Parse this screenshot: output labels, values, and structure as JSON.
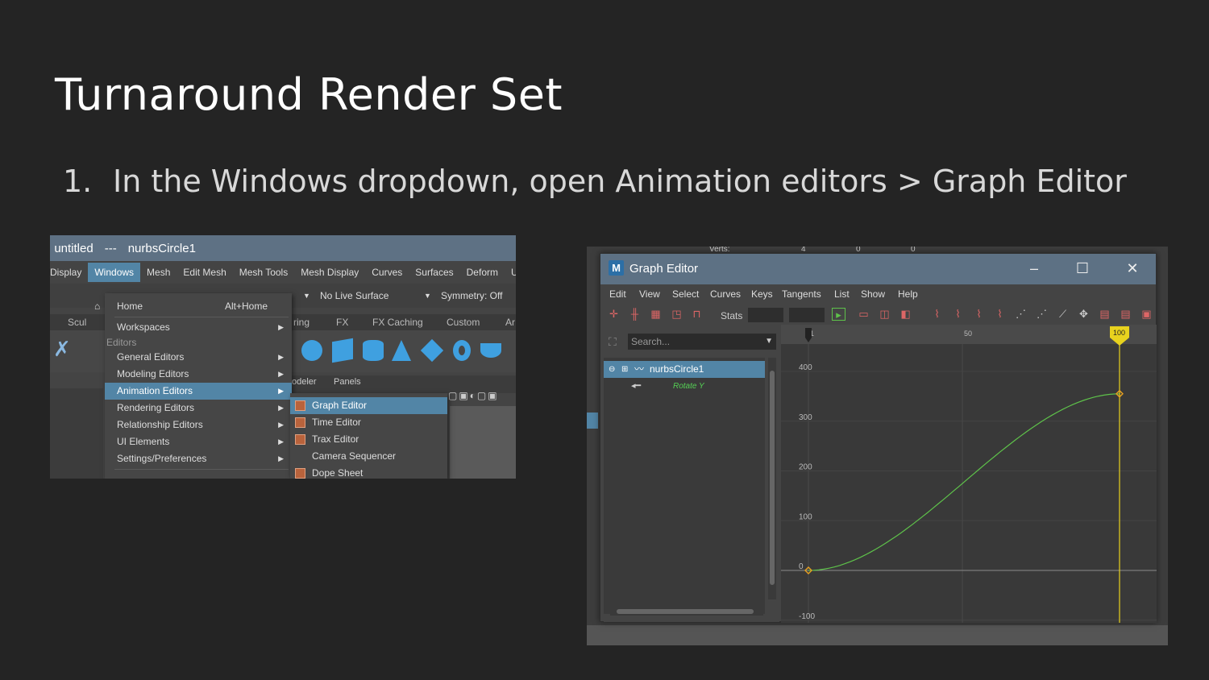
{
  "slide": {
    "title": "Turnaround Render Set",
    "step_number": "1.",
    "step_text": "In the Windows dropdown, open Animation editors > Graph Editor"
  },
  "maya_menu": {
    "title_prefix": ": untitled",
    "title_sep": "---",
    "title_object": "nurbsCircle1",
    "menubar": [
      "Display",
      "Windows",
      "Mesh",
      "Edit Mesh",
      "Mesh Tools",
      "Mesh Display",
      "Curves",
      "Surfaces",
      "Deform",
      "UV"
    ],
    "active_menu": "Windows",
    "live_surface": "No Live Surface",
    "symmetry": "Symmetry: Off",
    "shelf_tabs": [
      "Scul",
      "ring",
      "FX",
      "FX Caching",
      "Custom",
      "Ar"
    ],
    "panel_tabs": [
      "odeler",
      "Panels"
    ],
    "windows_menu": {
      "home": "Home",
      "home_shortcut": "Alt+Home",
      "workspaces": "Workspaces",
      "editors_section": "Editors",
      "items": [
        "General Editors",
        "Modeling Editors",
        "Animation Editors",
        "Rendering Editors",
        "Relationship Editors",
        "UI Elements",
        "Settings/Preferences"
      ],
      "highlighted": "Animation Editors"
    },
    "animation_submenu": [
      "Graph Editor",
      "Time Editor",
      "Trax Editor",
      "Camera Sequencer",
      "Dope Sheet"
    ],
    "animation_submenu_highlighted": "Graph Editor"
  },
  "graph_editor": {
    "title": "Graph Editor",
    "background_text": "Verts:",
    "background_values": [
      "4",
      "0",
      "0"
    ],
    "menus": [
      "Edit",
      "View",
      "Select",
      "Curves",
      "Keys",
      "Tangents",
      "List",
      "Show",
      "Help"
    ],
    "stats_label": "Stats",
    "search_placeholder": "Search...",
    "node": "nurbsCircle1",
    "attribute": "Rotate Y",
    "time_ticks": [
      "1",
      "50",
      "100"
    ],
    "current_frame": "100",
    "value_ticks": [
      "400",
      "300",
      "200",
      "100",
      "0",
      "-100"
    ],
    "colors": {
      "curve": "#5ec24a",
      "current_time": "#e8d21e",
      "key": "#e8a020",
      "selection": "#5285a6",
      "title_bar": "#5d7184"
    }
  }
}
